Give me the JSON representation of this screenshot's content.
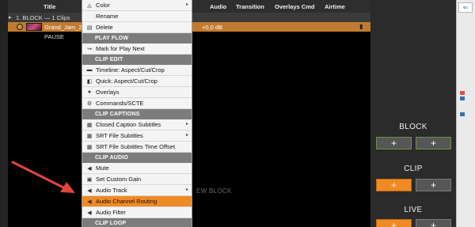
{
  "table": {
    "columns": {
      "title": "Title",
      "audio": "Audio",
      "transition": "Transition",
      "overlays": "Overlays Cmd",
      "airtime": "Airtime"
    },
    "block_row": {
      "label": "1. BLOCK — 1 Clips"
    },
    "clip_row": {
      "name": "Grand_Jam_2",
      "audio": "+0,0 dB"
    },
    "pause_row": {
      "label": "PAUSE"
    },
    "ghost_text": "EW BLOCK"
  },
  "menu": {
    "items": [
      {
        "kind": "item",
        "icon": "color-bucket-icon",
        "glyph": "◬",
        "label": "Color",
        "submenu": true
      },
      {
        "kind": "item",
        "icon": "",
        "glyph": "",
        "label": "Rename",
        "submenu": false
      },
      {
        "kind": "item",
        "icon": "delete-icon",
        "glyph": "▤",
        "label": "Delete",
        "submenu": false
      },
      {
        "kind": "section",
        "label": "PLAY FLOW"
      },
      {
        "kind": "item",
        "icon": "mark-play-next-icon",
        "glyph": "↪",
        "label": "Mark for Play Next",
        "submenu": false
      },
      {
        "kind": "section",
        "label": "CLIP EDIT"
      },
      {
        "kind": "item",
        "icon": "timeline-icon",
        "glyph": "▬",
        "label": "Timeline: Aspect/Cut/Crop",
        "submenu": false
      },
      {
        "kind": "item",
        "icon": "quick-edit-icon",
        "glyph": "◧",
        "label": "Quick: Aspect/Cut/Crop",
        "submenu": false
      },
      {
        "kind": "item",
        "icon": "overlays-icon",
        "glyph": "●",
        "label": "Overlays",
        "submenu": false
      },
      {
        "kind": "item",
        "icon": "commands-icon",
        "glyph": "⚙",
        "label": "Commands/SCTE",
        "submenu": false
      },
      {
        "kind": "section",
        "label": "CLIP CAPTIONS"
      },
      {
        "kind": "item",
        "icon": "captions-icon",
        "glyph": "▦",
        "label": "Closed Caption Subtitles",
        "submenu": true
      },
      {
        "kind": "item",
        "icon": "srt-icon",
        "glyph": "▦",
        "label": "SRT File Subtitles",
        "submenu": true
      },
      {
        "kind": "item",
        "icon": "srt-offset-icon",
        "glyph": "▦",
        "label": "SRT File Subtitles Time Offset",
        "submenu": false
      },
      {
        "kind": "section",
        "label": "CLIP AUDIO"
      },
      {
        "kind": "item",
        "icon": "mute-icon",
        "glyph": "◀",
        "label": "Mute",
        "submenu": false
      },
      {
        "kind": "item",
        "icon": "gain-icon",
        "glyph": "▣",
        "label": "Set Custom Gain",
        "submenu": false
      },
      {
        "kind": "item",
        "icon": "audio-track-icon",
        "glyph": "◀",
        "label": "Audio Track",
        "submenu": true
      },
      {
        "kind": "item",
        "icon": "speaker-icon",
        "glyph": "◀",
        "label": "Audio Channel Routing",
        "submenu": false,
        "highlight": true
      },
      {
        "kind": "item",
        "icon": "speaker-icon",
        "glyph": "◀",
        "label": "Audio Filter",
        "submenu": false
      },
      {
        "kind": "section",
        "label": "CLIP LOOP"
      }
    ]
  },
  "right_panel": {
    "block_label": "BLOCK",
    "clip_label": "CLIP",
    "live_label": "LIVE",
    "plus": "+"
  },
  "colors": {
    "accent": "#f08a24",
    "arrow": "#e0463c"
  }
}
